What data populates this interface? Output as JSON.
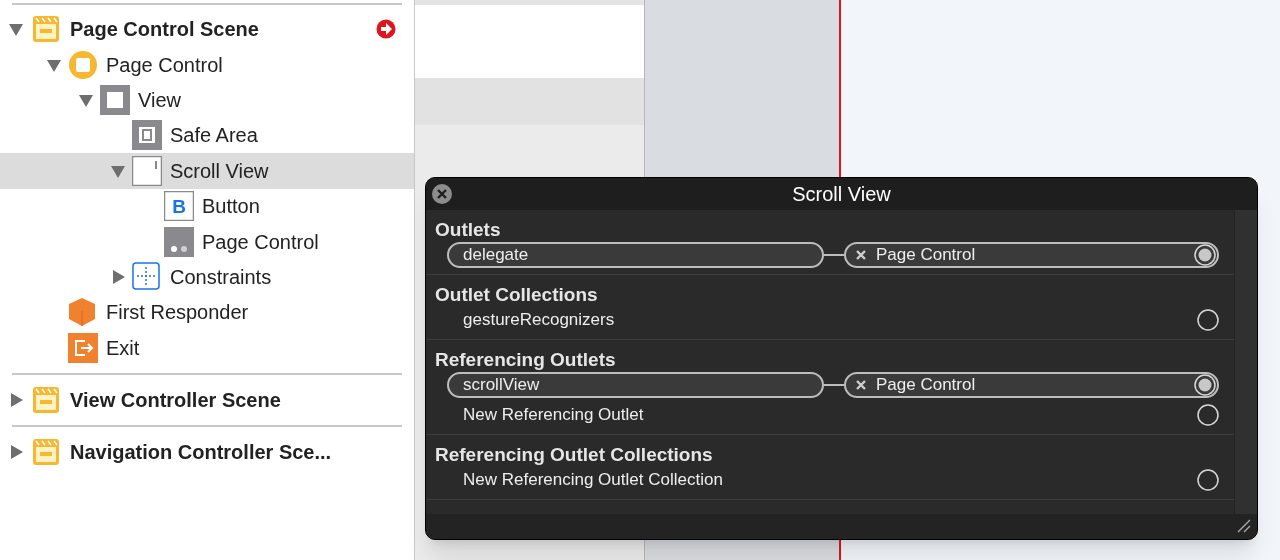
{
  "outline": [
    {
      "title": "Page Control Scene",
      "expanded": true,
      "warning": true,
      "children": [
        {
          "label": "Page Control",
          "kind": "controller",
          "expanded": true,
          "selected": false,
          "children": [
            {
              "label": "View",
              "kind": "view",
              "expanded": true,
              "selected": false,
              "children": [
                {
                  "label": "Safe Area",
                  "kind": "safe-area",
                  "selected": false
                },
                {
                  "label": "Scroll View",
                  "kind": "scroll-view",
                  "expanded": true,
                  "selected": true,
                  "children": [
                    {
                      "label": "Button",
                      "kind": "button",
                      "glyph": "B",
                      "selected": false
                    },
                    {
                      "label": "Page Control",
                      "kind": "page-control",
                      "selected": false
                    }
                  ]
                },
                {
                  "label": "Constraints",
                  "kind": "constraints",
                  "expanded": false,
                  "selected": false
                }
              ]
            }
          ]
        },
        {
          "label": "First Responder",
          "kind": "responder",
          "selected": false
        },
        {
          "label": "Exit",
          "kind": "exit",
          "selected": false
        }
      ]
    },
    {
      "title": "View Controller Scene",
      "expanded": false,
      "warning": false
    },
    {
      "title": "Navigation Controller Sce...",
      "expanded": false,
      "warning": false
    }
  ],
  "popup": {
    "title": "Scroll View",
    "sections": [
      {
        "title": "Outlets",
        "rows": [
          {
            "kind": "connection",
            "name": "delegate",
            "target": "Page Control"
          }
        ]
      },
      {
        "title": "Outlet Collections",
        "rows": [
          {
            "kind": "empty",
            "name": "gestureRecognizers"
          }
        ]
      },
      {
        "title": "Referencing Outlets",
        "rows": [
          {
            "kind": "connection",
            "name": "scrollView",
            "target": "Page Control"
          },
          {
            "kind": "empty",
            "name": "New Referencing Outlet"
          }
        ]
      },
      {
        "title": "Referencing Outlet Collections",
        "rows": [
          {
            "kind": "empty",
            "name": "New Referencing Outlet Collection"
          }
        ]
      }
    ]
  }
}
